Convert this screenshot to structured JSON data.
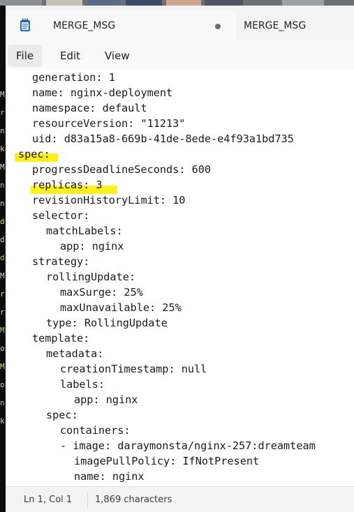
{
  "window": {
    "tabs": [
      {
        "title": "MERGE_MSG",
        "unsaved_dot": true
      },
      {
        "title": "MERGE_MSG"
      }
    ]
  },
  "menu": {
    "items": [
      "File",
      "Edit",
      "View"
    ]
  },
  "editor": {
    "lines": [
      "generation: 1",
      "name: nginx-deployment",
      "namespace: default",
      "resourceVersion: \"11213\"",
      "uid: d83a15a8-669b-41de-8ede-e4f93a1bd735",
      "spec:",
      "progressDeadlineSeconds: 600",
      "replicas: 3",
      "revisionHistoryLimit: 10",
      "selector:",
      "matchLabels:",
      "app: nginx",
      "strategy:",
      "rollingUpdate:",
      "maxSurge: 25%",
      "maxUnavailable: 25%",
      "type: RollingUpdate",
      "template:",
      "metadata:",
      "creationTimestamp: null",
      "labels:",
      "app: nginx",
      "spec:",
      "containers:",
      "- image: daraymonsta/nginx-257:dreamteam",
      "imagePullPolicy: IfNotPresent",
      "name: nginx"
    ],
    "highlighted_lines": [
      "spec:",
      "replicas: 3"
    ],
    "highlight_color": "#ffef1f"
  },
  "statusbar": {
    "position": "Ln 1, Col 1",
    "characters": "1,869 characters"
  },
  "colors": {
    "tab_bar": "#f3f3f3",
    "editor_background": "#ffffff",
    "text": "#1a1a1a",
    "icon_accent": "#2b6cb0"
  },
  "background_terminal": {
    "glyphs": [
      "M",
      "r",
      "n",
      "k",
      "M",
      "n",
      "n",
      "d",
      "d",
      "d",
      "M",
      "r",
      "r",
      "M",
      "o",
      "M",
      "o",
      "n",
      "k"
    ]
  }
}
